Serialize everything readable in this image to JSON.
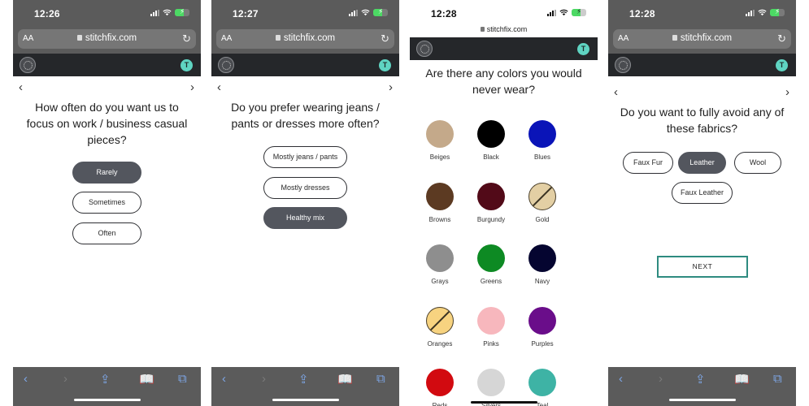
{
  "common": {
    "url": "stitchfix.com",
    "text_size_label": "AA",
    "avatar_initial": "T",
    "prev_arrow": "‹",
    "next_arrow": "›",
    "reload_glyph": "↻",
    "toolbar": {
      "back": "‹",
      "forward": "›",
      "share": "⇪",
      "bookmarks": "📖",
      "tabs": "⧉"
    }
  },
  "screens": [
    {
      "time": "12:26",
      "question": "How often do you want us to focus on work / business casual pieces?",
      "options": [
        {
          "label": "Rarely",
          "selected": true
        },
        {
          "label": "Sometimes",
          "selected": false
        },
        {
          "label": "Often",
          "selected": false
        }
      ]
    },
    {
      "time": "12:27",
      "question": "Do you prefer wearing jeans / pants or dresses more often?",
      "options": [
        {
          "label": "Mostly jeans / pants",
          "selected": false
        },
        {
          "label": "Mostly dresses",
          "selected": false
        },
        {
          "label": "Healthy mix",
          "selected": true
        }
      ]
    },
    {
      "time": "12:28",
      "question": "Are there any colors you would never wear?",
      "colors": [
        {
          "label": "Beiges",
          "hex": "#c4a98a"
        },
        {
          "label": "Black",
          "hex": "#000000"
        },
        {
          "label": "Blues",
          "hex": "#0a14b8"
        },
        {
          "label": "Browns",
          "hex": "#5c3a22"
        },
        {
          "label": "Burgundy",
          "hex": "#520a18"
        },
        {
          "label": "Gold",
          "hex": "#e3cfa4",
          "striped": true
        },
        {
          "label": "Grays",
          "hex": "#8e8e8e"
        },
        {
          "label": "Greens",
          "hex": "#0d8a23"
        },
        {
          "label": "Navy",
          "hex": "#050530"
        },
        {
          "label": "Oranges",
          "hex": "#f7d380",
          "striped": true
        },
        {
          "label": "Pinks",
          "hex": "#f7b7bd"
        },
        {
          "label": "Purples",
          "hex": "#6a0d8a"
        },
        {
          "label": "Reds",
          "hex": "#d20a10"
        },
        {
          "label": "Silvers",
          "hex": "#d6d6d6"
        },
        {
          "label": "Teal",
          "hex": "#3eb3a5"
        }
      ]
    },
    {
      "time": "12:28",
      "question": "Do you want to fully avoid any of these fabrics?",
      "options": [
        {
          "label": "Faux Fur",
          "selected": false
        },
        {
          "label": "Leather",
          "selected": true
        },
        {
          "label": "Wool",
          "selected": false
        },
        {
          "label": "Faux Leather",
          "selected": false
        }
      ],
      "next_label": "NEXT"
    }
  ],
  "colors": {
    "selected_option_bg": "#53565e",
    "site_header_bg": "#25272a",
    "avatar_bg": "#5fd4c2",
    "next_border": "#2e8b80",
    "browser_chrome": "#5b5b5b"
  }
}
